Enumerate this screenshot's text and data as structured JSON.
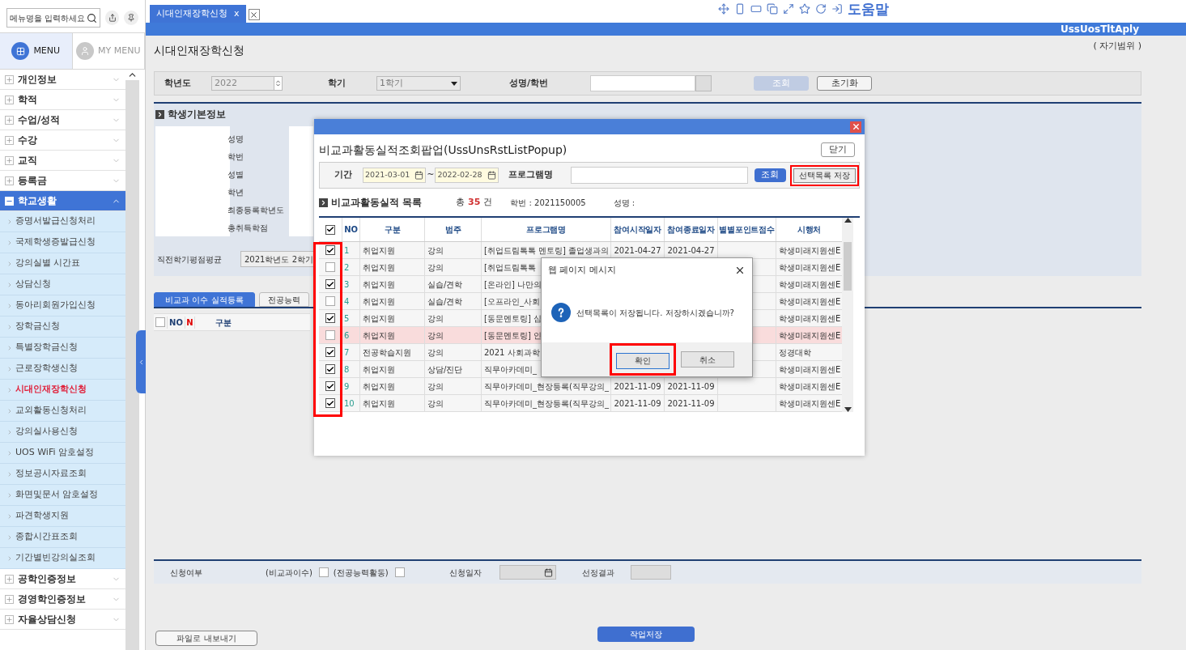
{
  "sidebar": {
    "search": {
      "placeholder": "메뉴명을 입력하세요"
    },
    "menu_tabs": [
      {
        "label": "MENU",
        "selected": true
      },
      {
        "label": "MY MENU",
        "selected": false
      }
    ],
    "groups": [
      {
        "label": "개인정보",
        "expanded": false
      },
      {
        "label": "학적",
        "expanded": false
      },
      {
        "label": "수업/성적",
        "expanded": false
      },
      {
        "label": "수강",
        "expanded": false
      },
      {
        "label": "교직",
        "expanded": false
      },
      {
        "label": "등록금",
        "expanded": false
      },
      {
        "label": "학교생활",
        "expanded": true,
        "children": [
          {
            "label": "증명서발급신청처리",
            "selected": false
          },
          {
            "label": "국제학생증발급신청",
            "selected": false
          },
          {
            "label": "강의실별 시간표",
            "selected": false
          },
          {
            "label": "상담신청",
            "selected": false
          },
          {
            "label": "동아리회원가입신청",
            "selected": false
          },
          {
            "label": "장학금신청",
            "selected": false
          },
          {
            "label": "특별장학금신청",
            "selected": false
          },
          {
            "label": "근로장학생신청",
            "selected": false
          },
          {
            "label": "시대인재장학신청",
            "selected": true
          },
          {
            "label": "교외활동신청처리",
            "selected": false
          },
          {
            "label": "강의실사용신청",
            "selected": false
          },
          {
            "label": "UOS WiFi 암호설정",
            "selected": false
          },
          {
            "label": "정보공시자료조회",
            "selected": false
          },
          {
            "label": "화면및문서 암호설정",
            "selected": false
          },
          {
            "label": "파견학생지원",
            "selected": false
          },
          {
            "label": "종합시간표조회",
            "selected": false
          },
          {
            "label": "기간별빈강의실조회",
            "selected": false
          }
        ]
      },
      {
        "label": "공학인증정보",
        "expanded": false
      },
      {
        "label": "경영학인증정보",
        "expanded": false
      },
      {
        "label": "자율상담신청",
        "expanded": false
      }
    ]
  },
  "tab_bar": {
    "tabs": [
      {
        "label": "시대인재장학신청",
        "close": "x",
        "selected": true
      }
    ]
  },
  "toolbar": {
    "help": "도움말"
  },
  "header_bar": {
    "program_id": "UssUosTltAply"
  },
  "page": {
    "title": "시대인재장학신청",
    "scope": "( 자기범위 )",
    "search": {
      "year": {
        "label": "학년도",
        "value": "2022"
      },
      "term": {
        "label": "학기",
        "value": "1학기"
      },
      "name": {
        "label": "성명/학번"
      },
      "buttons": [
        {
          "label": "조회",
          "disabled": true
        },
        {
          "label": "초기화",
          "disabled": false
        }
      ]
    },
    "student_info": {
      "title": "학생기본정보",
      "labels": [
        "성명",
        "학번",
        "성별",
        "학년",
        "최종등록학년도",
        "총취득학점"
      ],
      "gpa": {
        "label": "직전학기평점평균",
        "value": "2021학년도 2학기"
      }
    },
    "tabs": [
      {
        "label": "비교과 이수 실적등록",
        "selected": true
      },
      {
        "label": "전공능력",
        "selected": false
      }
    ],
    "grid": {
      "header_checked": false,
      "columns": [
        {
          "label": "NO",
          "color": "#1f3f73"
        },
        {
          "label": "N",
          "color": "#e00000"
        },
        {
          "label": "구분",
          "color": "#1f3f73"
        }
      ]
    },
    "application": {
      "status_label": "신청여부",
      "options": [
        {
          "label": "(비교과이수)",
          "checked": false
        },
        {
          "label": "(전공능력활동)",
          "checked": false
        }
      ],
      "date_label": "신청일자",
      "result_label": "선정결과"
    },
    "buttons": {
      "export": "파일로 내보내기",
      "save": "작업저장"
    }
  },
  "popup": {
    "title": "비교과활동실적조회팝업(UssUnsRstListPopup)",
    "close": "닫기",
    "filter": {
      "period_label": "기간",
      "from": "2021-03-01",
      "separator": "~",
      "to": "2022-02-28",
      "program_label": "프로그램명",
      "search": "조회",
      "save_selected": "선택목록 저장"
    },
    "list_title": "비교과활동실적 목록",
    "total_prefix": "총",
    "total": "35",
    "total_suffix": "건",
    "student_no": "학번 : 2021150005",
    "name": "성명 :",
    "table": {
      "header_checked": true,
      "columns": [
        "NO",
        "구분",
        "범주",
        "프로그램명",
        "참여시작일자",
        "참여종료일자",
        "별별포인트점수",
        "시행처"
      ],
      "rows": [
        {
          "checked": true,
          "highlighted": false,
          "no": "1",
          "category": "취업지원",
          "type": "강의",
          "program": "[취업드림톡톡 멘토링] 졸업생과의",
          "start": "2021-04-27",
          "end": "2021-04-27",
          "org": "학생미래지원센E"
        },
        {
          "checked": false,
          "highlighted": false,
          "no": "2",
          "category": "취업지원",
          "type": "강의",
          "program": "[취업드림톡톡",
          "org": "학생미래지원센E"
        },
        {
          "checked": true,
          "highlighted": false,
          "no": "3",
          "category": "취업지원",
          "type": "실습/견학",
          "program": "[온라인] 나만의",
          "org": "학생미래지원센E"
        },
        {
          "checked": false,
          "highlighted": false,
          "no": "4",
          "category": "취업지원",
          "type": "실습/견학",
          "program": "[오프라인_사회",
          "org": "학생미래지원센E"
        },
        {
          "checked": true,
          "highlighted": false,
          "no": "5",
          "category": "취업지원",
          "type": "강의",
          "program": "[동문멘토링] 심",
          "org": "학생미래지원센E"
        },
        {
          "checked": false,
          "highlighted": true,
          "no": "6",
          "category": "취업지원",
          "type": "강의",
          "program": "[동문멘토링] 인",
          "org": "학생미래지원센E"
        },
        {
          "checked": true,
          "highlighted": false,
          "no": "7",
          "category": "전공학습지원",
          "type": "강의",
          "program": "2021 사회과학",
          "org": "정경대학"
        },
        {
          "checked": true,
          "highlighted": false,
          "no": "8",
          "category": "취업지원",
          "type": "상담/진단",
          "program": "직무아카데미_",
          "org": "학생미래지원센E"
        },
        {
          "checked": true,
          "highlighted": false,
          "no": "9",
          "category": "취업지원",
          "type": "강의",
          "program": "직무아카데미_현장등록(직무강의_",
          "start": "2021-11-09",
          "end": "2021-11-09",
          "org": "학생미래지원센E"
        },
        {
          "checked": true,
          "highlighted": false,
          "no": "10",
          "category": "취업지원",
          "type": "강의",
          "program": "직무아카데미_현장등록(직무강의_",
          "start": "2021-11-09",
          "end": "2021-11-09",
          "org": "학생미래지원센E"
        }
      ]
    }
  },
  "dialog": {
    "title": "웹 페이지 메시지",
    "message": "선택목록이 저장됩니다. 저장하시겠습니까?",
    "buttons": [
      {
        "label": "확인",
        "selected": true
      },
      {
        "label": "취소",
        "selected": false
      }
    ]
  }
}
